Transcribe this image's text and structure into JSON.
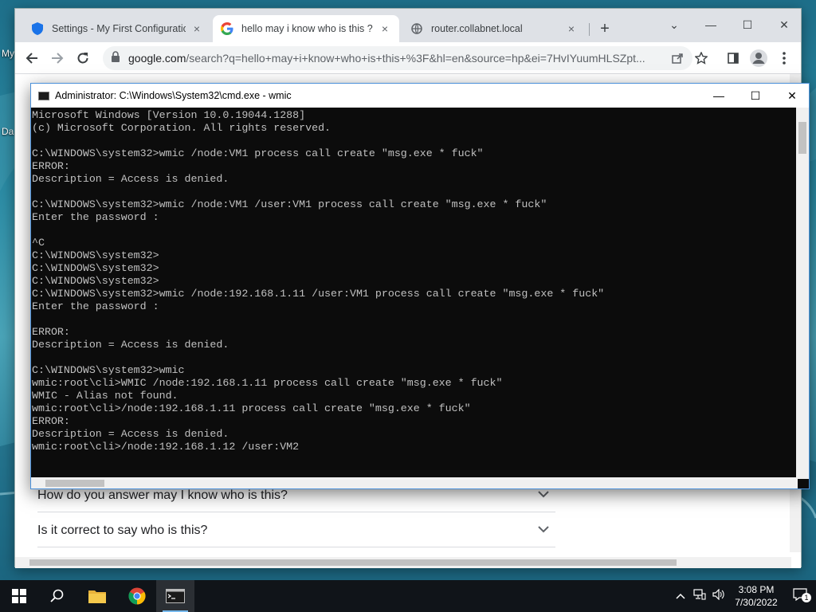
{
  "desktop": {
    "icon_labels": [
      "My",
      "Da"
    ]
  },
  "chrome": {
    "tabs": [
      {
        "label": "Settings - My First Configuration",
        "icon": "shield-icon",
        "close": "×",
        "active": false
      },
      {
        "label": "hello may i know who is this ? - G",
        "icon": "google-icon",
        "close": "×",
        "active": true
      },
      {
        "label": "router.collabnet.local",
        "icon": "globe-icon",
        "close": "×",
        "active": false
      }
    ],
    "new_tab": "+",
    "window_controls": {
      "tab_search": "⌄",
      "minimize": "—",
      "maximize": "☐",
      "close": "✕"
    },
    "address": {
      "host": "google.com",
      "path": "/search?q=hello+may+i+know+who+is+this+%3F&hl=en&source=hp&ei=7HvIYuumHLSZpt..."
    }
  },
  "page": {
    "faq": [
      {
        "question": "How do you answer may I know who is this?"
      },
      {
        "question": "Is it correct to say who is this?"
      }
    ]
  },
  "cmd": {
    "title": "Administrator: C:\\Windows\\System32\\cmd.exe - wmic",
    "lines": [
      "Microsoft Windows [Version 10.0.19044.1288]",
      "(c) Microsoft Corporation. All rights reserved.",
      "",
      "C:\\WINDOWS\\system32>wmic /node:VM1 process call create \"msg.exe * fuck\"",
      "ERROR:",
      "Description = Access is denied.",
      "",
      "C:\\WINDOWS\\system32>wmic /node:VM1 /user:VM1 process call create \"msg.exe * fuck\"",
      "Enter the password :",
      "",
      "^C",
      "C:\\WINDOWS\\system32>",
      "C:\\WINDOWS\\system32>",
      "C:\\WINDOWS\\system32>",
      "C:\\WINDOWS\\system32>wmic /node:192.168.1.11 /user:VM1 process call create \"msg.exe * fuck\"",
      "Enter the password :",
      "",
      "ERROR:",
      "Description = Access is denied.",
      "",
      "C:\\WINDOWS\\system32>wmic",
      "wmic:root\\cli>WMIC /node:192.168.1.11 process call create \"msg.exe * fuck\"",
      "WMIC - Alias not found.",
      "wmic:root\\cli>/node:192.168.1.11 process call create \"msg.exe * fuck\"",
      "ERROR:",
      "Description = Access is denied.",
      "wmic:root\\cli>/node:192.168.1.12 /user:VM2"
    ]
  },
  "taskbar": {
    "apps": [
      "start-button",
      "search",
      "file-explorer",
      "chrome",
      "cmd"
    ],
    "time": "3:08 PM",
    "date": "7/30/2022",
    "notifications": "1"
  }
}
